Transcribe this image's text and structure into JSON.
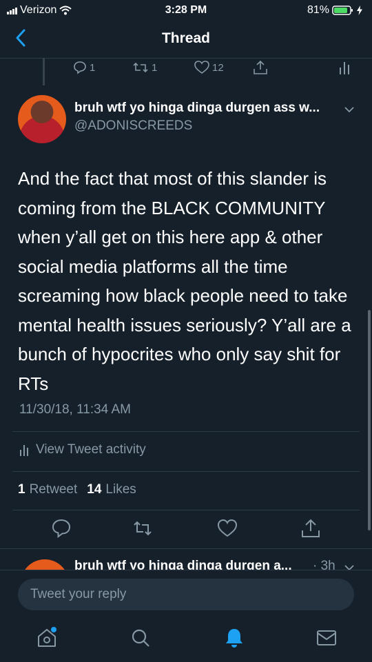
{
  "status_bar": {
    "carrier": "Verizon",
    "time": "3:28 PM",
    "battery": "81%"
  },
  "nav": {
    "title": "Thread"
  },
  "prev_tweet_actions": {
    "reply_count": "1",
    "retweet_count": "1",
    "like_count": "12"
  },
  "tweet": {
    "display_name": "bruh wtf yo hinga dinga durgen ass w...",
    "handle": "@ADONISCREEDS",
    "text": "And the fact that most of this slander is coming from the BLACK COMMUNITY when y’all get on this here app & other social media platforms all the time screaming how black people need to take mental health issues seriously? Y’all are a bunch of hypocrites who only say shit for RTs",
    "timestamp": "11/30/18, 11:34 AM",
    "activity_label": "View Tweet activity",
    "retweets_count": "1",
    "retweets_label": "Retweet",
    "likes_count": "14",
    "likes_label": "Likes"
  },
  "reply_preview": {
    "display_name": "bruh wtf yo hinga dinga durgen a...",
    "age": "· 3h"
  },
  "composer": {
    "placeholder": "Tweet your reply"
  },
  "tabs": [
    "home-icon",
    "search-icon",
    "notifications-icon",
    "messages-icon"
  ],
  "colors": {
    "background": "#15202b",
    "accent": "#1da1f2",
    "secondary_text": "#8899a6"
  }
}
